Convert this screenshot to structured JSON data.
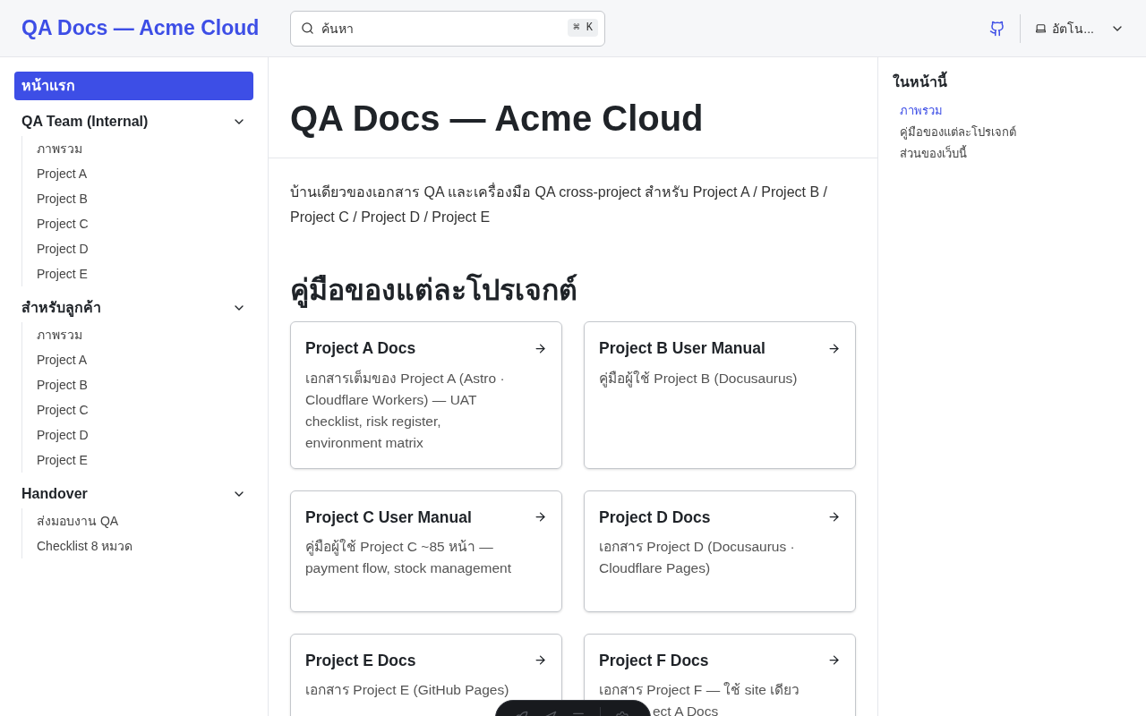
{
  "header": {
    "site_title": "QA Docs — Acme Cloud",
    "search": {
      "placeholder": "ค้นหา",
      "shortcut": "⌘ K"
    },
    "theme_select": {
      "value": "อัตโน..."
    }
  },
  "sidebar": {
    "items": [
      {
        "label": "หน้าแรก",
        "selected": true
      }
    ],
    "groups": [
      {
        "label": "QA Team (Internal)",
        "expanded": true,
        "items": [
          {
            "label": "ภาพรวม",
            "selected": false
          },
          {
            "label": "Project A",
            "selected": false
          },
          {
            "label": "Project B",
            "selected": false
          },
          {
            "label": "Project C",
            "selected": false
          },
          {
            "label": "Project D",
            "selected": false
          },
          {
            "label": "Project E",
            "selected": false
          }
        ]
      },
      {
        "label": "สำหรับลูกค้า",
        "expanded": true,
        "items": [
          {
            "label": "ภาพรวม",
            "selected": false
          },
          {
            "label": "Project A",
            "selected": false
          },
          {
            "label": "Project B",
            "selected": false
          },
          {
            "label": "Project C",
            "selected": false
          },
          {
            "label": "Project D",
            "selected": false
          },
          {
            "label": "Project E",
            "selected": false
          }
        ]
      },
      {
        "label": "Handover",
        "expanded": true,
        "items": [
          {
            "label": "ส่งมอบงาน QA",
            "selected": false
          },
          {
            "label": "Checklist 8 หมวด",
            "selected": false
          }
        ]
      }
    ]
  },
  "main": {
    "title": "QA Docs — Acme Cloud",
    "intro": "บ้านเดียวของเอกสาร QA และเครื่องมือ QA cross-project สำหรับ Project A / Project B / Project C / Project D / Project E",
    "section_heading": "คู่มือของแต่ละโปรเจกต์",
    "cards": [
      {
        "title": "Project A Docs",
        "description": "เอกสารเต็มของ Project A (Astro · Cloudflare Workers) — UAT checklist, risk register, environment matrix"
      },
      {
        "title": "Project B User Manual",
        "description": "คู่มือผู้ใช้ Project B (Docusaurus)"
      },
      {
        "title": "Project C User Manual",
        "description": "คู่มือผู้ใช้ Project C ~85 หน้า — payment flow, stock management"
      },
      {
        "title": "Project D Docs",
        "description": "เอกสาร Project D (Docusaurus · Cloudflare Pages)"
      },
      {
        "title": "Project E Docs",
        "description": "เอกสาร Project E (GitHub Pages)"
      },
      {
        "title": "Project F Docs",
        "description": "เอกสาร Project F — ใช้ site เดียว",
        "description_cut": "ect A Docs"
      }
    ]
  },
  "toc": {
    "title": "ในหน้านี้",
    "items": [
      {
        "label": "ภาพรวม",
        "selected": true
      },
      {
        "label": "คู่มือของแต่ละโปรเจกต์",
        "selected": false
      },
      {
        "label": "ส่วนของเว็บนี้",
        "selected": false
      }
    ]
  }
}
